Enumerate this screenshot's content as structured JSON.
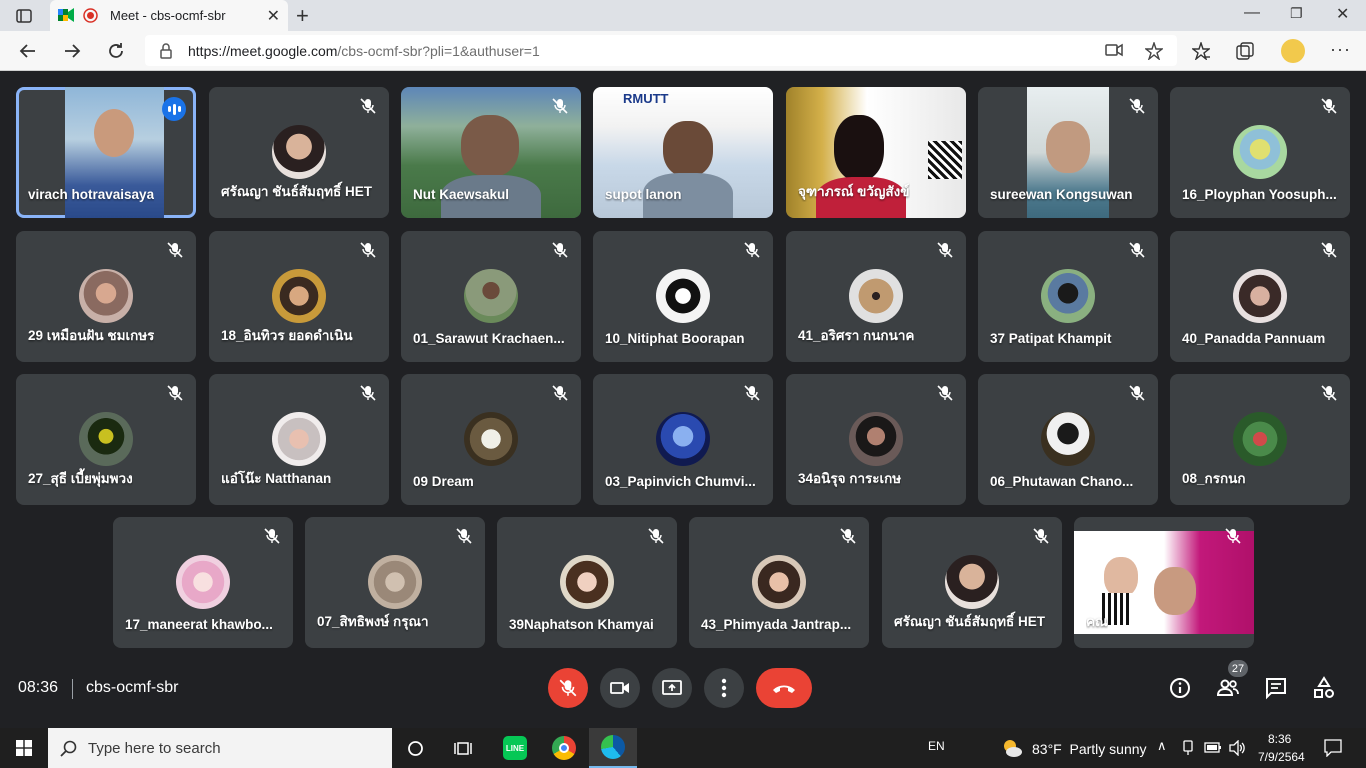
{
  "browser": {
    "tab_title": "Meet - cbs-ocmf-sbr",
    "url_host": "https://meet.google.com",
    "url_path": "/cbs-ocmf-sbr?pli=1&authuser=1"
  },
  "participants_row1": [
    "virach hotravaisaya",
    "ศรัณญา ชันธ์สัมฤทธิ์ HET",
    "Nut Kaewsakul",
    "supot lanon",
    "จุฑาภรณ์ ขวัญสังข์",
    "sureewan Kongsuwan",
    "16_Ployphan Yoosuph..."
  ],
  "participants_row2": [
    "29 เหมือนฝัน ชมเกษร",
    "18_อินทิวร ยอดดำเนิน",
    "01_Sarawut Krachaen...",
    "10_Nitiphat Boorapan",
    "41_อริศรา กนกนาค",
    "37 Patipat Khampit",
    "40_Panadda Pannuam"
  ],
  "participants_row3": [
    "27_สุธี เบี้ยพุ่มพวง",
    "แอ๋โน๊ะ Natthanan",
    "09 Dream",
    "03_Papinvich Chumvi...",
    "34อนิรุจ การะเกษ",
    "06_Phutawan Chano...",
    "08_กรกนก"
  ],
  "participants_row4": [
    "17_maneerat khawbo...",
    "07_สิทธิพงษ์ กรุณา",
    "39Naphatson Khamyai",
    "43_Phimyada Jantrap...",
    "ศรัณญา ชันธ์สัมฤทธิ์ HET",
    "คณ"
  ],
  "rmutt_logo": "RMUTT",
  "meeting": {
    "time": "08:36",
    "code": "cbs-ocmf-sbr",
    "people_count": "27"
  },
  "taskbar": {
    "search_placeholder": "Type here to search",
    "lang": "EN",
    "weather": "83°F  Partly sunny",
    "clock_time": "8:36",
    "clock_date": "7/9/2564"
  },
  "colors": {
    "meet_bg": "#202124",
    "tile_bg": "#3c4043",
    "accent_blue": "#8ab4f8",
    "danger_red": "#ea4335"
  }
}
